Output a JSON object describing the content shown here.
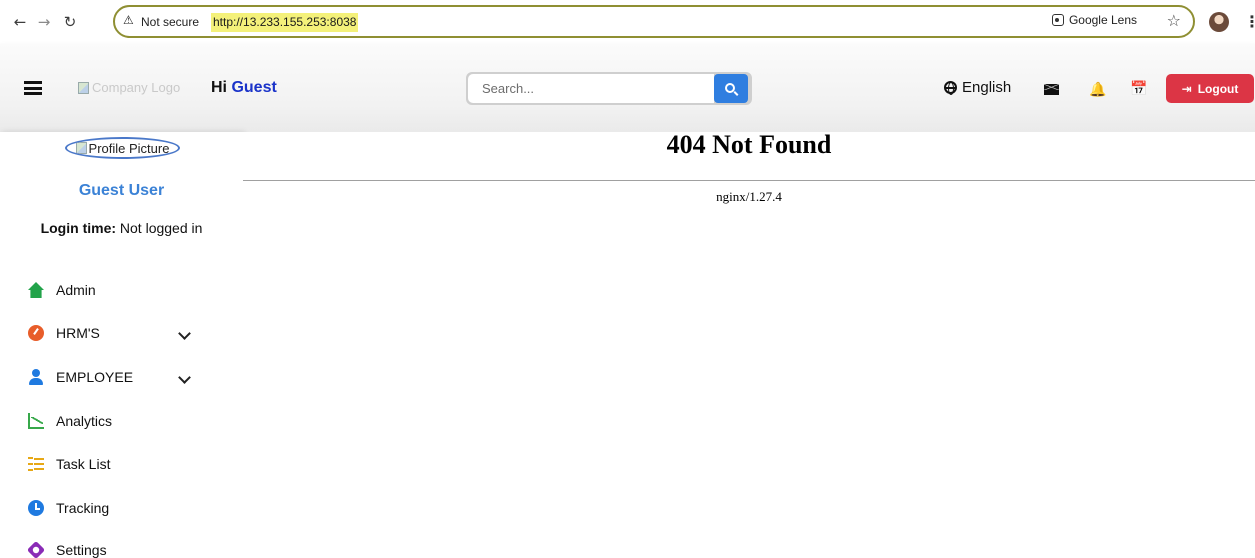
{
  "browser": {
    "security_label": "Not secure",
    "url": "http://13.233.155.253:8038",
    "lens_label": "Google Lens"
  },
  "header": {
    "logo_alt": "Company Logo",
    "greeting_prefix": "Hi",
    "greeting_name": "Guest",
    "search_placeholder": "Search...",
    "language": "English",
    "logout_label": "Logout"
  },
  "sidebar": {
    "profile_alt": "Profile Picture",
    "user_name": "Guest User",
    "login_label": "Login time:",
    "login_value": "Not logged in",
    "items": [
      {
        "label": "Admin",
        "icon": "home-icon",
        "expandable": false
      },
      {
        "label": "HRM'S",
        "icon": "gauge-icon",
        "expandable": true
      },
      {
        "label": "EMPLOYEE",
        "icon": "user-icon",
        "expandable": true
      },
      {
        "label": "Analytics",
        "icon": "chart-line-icon",
        "expandable": false
      },
      {
        "label": "Task List",
        "icon": "task-list-icon",
        "expandable": false
      },
      {
        "label": "Tracking",
        "icon": "clock-icon",
        "expandable": false
      },
      {
        "label": "Settings",
        "icon": "gear-icon",
        "expandable": false
      }
    ]
  },
  "main": {
    "error_title": "404 Not Found",
    "server_info": "nginx/1.27.4"
  },
  "colors": {
    "logout_bg": "#dc3545",
    "search_button_bg": "#2f7ee0",
    "user_name_color": "#3b82d6",
    "greeting_name_color": "#1a33c9"
  }
}
